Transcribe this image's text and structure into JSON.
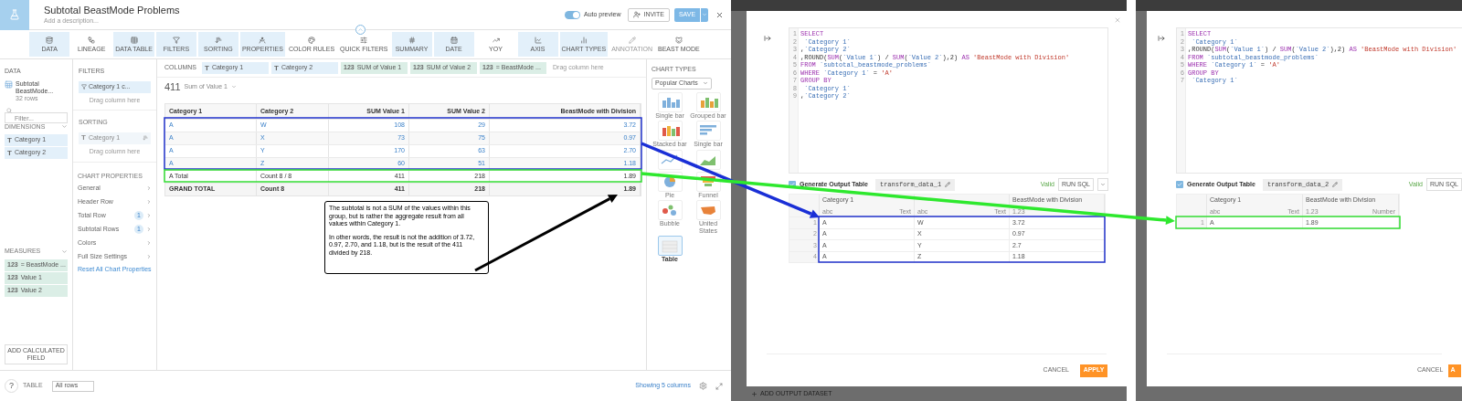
{
  "editor": {
    "title": "Subtotal BeastMode Problems",
    "description": "Add a description...",
    "auto_preview": {
      "label": "Auto preview",
      "on": true
    },
    "invite": "INVITE",
    "save": "SAVE"
  },
  "toolbar": [
    {
      "label": "DATA",
      "selected": true,
      "disabled": false
    },
    {
      "label": "LINEAGE",
      "selected": false,
      "disabled": false
    },
    {
      "label": "DATA TABLE",
      "selected": true,
      "disabled": false
    },
    {
      "label": "FILTERS",
      "selected": true,
      "disabled": false
    },
    {
      "label": "SORTING",
      "selected": true,
      "disabled": false
    },
    {
      "label": "PROPERTIES",
      "selected": true,
      "disabled": false
    },
    {
      "label": "COLOR RULES",
      "selected": false,
      "disabled": false
    },
    {
      "label": "QUICK FILTERS",
      "selected": false,
      "disabled": false
    },
    {
      "label": "SUMMARY",
      "selected": true,
      "disabled": false
    },
    {
      "label": "DATE",
      "selected": true,
      "disabled": false
    },
    {
      "label": "YOY",
      "selected": false,
      "disabled": false
    },
    {
      "label": "AXIS",
      "selected": true,
      "disabled": false
    },
    {
      "label": "CHART TYPES",
      "selected": true,
      "disabled": false
    },
    {
      "label": "ANNOTATION",
      "selected": false,
      "disabled": true
    },
    {
      "label": "BEAST MODE",
      "selected": false,
      "disabled": false
    }
  ],
  "data_panel": {
    "heading": "DATA",
    "dataset": {
      "name": "Subtotal BeastMode...",
      "rows": "32 rows"
    },
    "filter_placeholder": "Filter...",
    "dimensions": {
      "heading": "DIMENSIONS",
      "items": [
        {
          "type": "T",
          "label": "Category 1"
        },
        {
          "type": "T",
          "label": "Category 2"
        }
      ]
    },
    "measures": {
      "heading": "MEASURES",
      "items": [
        {
          "type": "123",
          "label": "= BeastMode ..."
        },
        {
          "type": "123",
          "label": "Value 1"
        },
        {
          "type": "123",
          "label": "Value 2"
        }
      ]
    },
    "add_button": "ADD CALCULATED FIELD"
  },
  "filters_panel": {
    "heading": "FILTERS",
    "chips": [
      "Category 1 c..."
    ],
    "drop_hint": "Drag column here",
    "sorting": {
      "heading": "SORTING",
      "chips": [
        {
          "type": "T",
          "label": "Category 1"
        }
      ],
      "drop_hint": "Drag column here"
    },
    "properties": {
      "heading": "CHART PROPERTIES",
      "items": [
        {
          "label": "General"
        },
        {
          "label": "Header Row"
        },
        {
          "label": "Total Row",
          "count": "1"
        },
        {
          "label": "Subtotal Rows",
          "count": "1"
        },
        {
          "label": "Colors"
        },
        {
          "label": "Full Size Settings"
        }
      ],
      "reset": "Reset All Chart Properties"
    }
  },
  "columns_bar": {
    "label": "COLUMNS",
    "chips": [
      {
        "type": "T",
        "label": "Category 1",
        "kind": "dimension"
      },
      {
        "type": "T",
        "label": "Category 2",
        "kind": "dimension"
      },
      {
        "type": "123",
        "label": "SUM of Value 1",
        "kind": "measure"
      },
      {
        "type": "123",
        "label": "SUM of Value 2",
        "kind": "measure"
      },
      {
        "type": "123",
        "label": "= BeastMode ...",
        "kind": "measure"
      }
    ],
    "drop_hint": "Drag column here"
  },
  "summary": {
    "value": "411",
    "label": "Sum of Value 1"
  },
  "table": {
    "columns": [
      "Category 1",
      "Category 2",
      "SUM Value 1",
      "SUM Value 2",
      "BeastMode with Division"
    ],
    "rows": [
      {
        "kind": "data",
        "cells": [
          "A",
          "W",
          "108",
          "29",
          "3.72"
        ]
      },
      {
        "kind": "data",
        "cells": [
          "A",
          "X",
          "73",
          "75",
          "0.97"
        ]
      },
      {
        "kind": "data",
        "cells": [
          "A",
          "Y",
          "170",
          "63",
          "2.70"
        ]
      },
      {
        "kind": "data",
        "cells": [
          "A",
          "Z",
          "60",
          "51",
          "1.18"
        ]
      },
      {
        "kind": "subtotal",
        "cells": [
          "A Total",
          "Count 8 / 8",
          "411",
          "218",
          "1.89"
        ]
      },
      {
        "kind": "total",
        "cells": [
          "GRAND TOTAL",
          "Count 8",
          "411",
          "218",
          "1.89"
        ]
      }
    ]
  },
  "note": [
    "The subtotal is not a SUM of the values within this group, but is rather the aggregate result from all values within Category 1.",
    "In other words, the result is not the addition of 3.72, 0.97, 2.70, and 1.18, but is the result of the 411 divided by 218."
  ],
  "chart_types": {
    "heading": "CHART TYPES",
    "dropdown": "Popular Charts",
    "tiles": [
      {
        "label": "Single bar",
        "selected": false
      },
      {
        "label": "Grouped bar",
        "selected": false
      },
      {
        "label": "Stacked bar",
        "selected": false
      },
      {
        "label": "Single bar",
        "selected": false
      },
      {
        "selected": false
      },
      {
        "selected": false
      },
      {
        "label": "Pie",
        "selected": false
      },
      {
        "label": "Funnel",
        "selected": false
      },
      {
        "label": "Bubble",
        "selected": false
      },
      {
        "label": "United States",
        "selected": false
      },
      {
        "label": "Table",
        "selected": true
      }
    ]
  },
  "footer": {
    "help": "?",
    "view": "TABLE",
    "rows_select": "All rows",
    "columns_info": "Showing 5 columns"
  },
  "sql_modals": [
    {
      "code": [
        {
          "n": "1",
          "tokens": [
            {
              "t": "SELECT",
              "kind": "keyword"
            }
          ]
        },
        {
          "n": "2",
          "tokens": [
            {
              "t": " `Category 1`",
              "kind": "identifier"
            }
          ]
        },
        {
          "n": "3",
          "tokens": [
            {
              "t": ",",
              "kind": "plain"
            },
            {
              "t": "`Category 2`",
              "kind": "identifier"
            }
          ]
        },
        {
          "n": "4",
          "tokens": [
            {
              "t": ",ROUND(",
              "kind": "plain"
            },
            {
              "t": "SUM",
              "kind": "keyword"
            },
            {
              "t": "(",
              "kind": "plain"
            },
            {
              "t": "`Value 1`",
              "kind": "identifier"
            },
            {
              "t": ") / ",
              "kind": "plain"
            },
            {
              "t": "SUM",
              "kind": "keyword"
            },
            {
              "t": "(",
              "kind": "plain"
            },
            {
              "t": "`Value 2`",
              "kind": "identifier"
            },
            {
              "t": "),2) ",
              "kind": "plain"
            },
            {
              "t": "AS",
              "kind": "keyword"
            },
            {
              "t": " 'BeastMode with Division'",
              "kind": "string"
            }
          ]
        },
        {
          "n": "5",
          "tokens": [
            {
              "t": "FROM",
              "kind": "keyword"
            },
            {
              "t": " `subtotal_beastmode_problems`",
              "kind": "identifier"
            }
          ]
        },
        {
          "n": "6",
          "tokens": [
            {
              "t": "WHERE",
              "kind": "keyword"
            },
            {
              "t": " `Category 1`",
              "kind": "identifier"
            },
            {
              "t": " = ",
              "kind": "plain"
            },
            {
              "t": "'A'",
              "kind": "string"
            }
          ]
        },
        {
          "n": "7",
          "tokens": [
            {
              "t": "GROUP BY",
              "kind": "keyword"
            }
          ]
        },
        {
          "n": "8",
          "tokens": [
            {
              "t": " `Category 1`",
              "kind": "identifier"
            }
          ]
        },
        {
          "n": "9",
          "tokens": [
            {
              "t": ",",
              "kind": "plain"
            },
            {
              "t": "`Category 2`",
              "kind": "identifier"
            }
          ]
        }
      ],
      "generate": {
        "label": "Generate Output Table",
        "checked": true
      },
      "output_name": "transform_data_1",
      "status": "Valid",
      "run": "RUN SQL",
      "output": {
        "columns": [
          {
            "name": "Category 1",
            "type_glyph": "abc",
            "type": "Text"
          },
          {
            "type_glyph": "abc",
            "type": "Text"
          },
          {
            "name": "BeastMode with Division",
            "type_glyph": "1.23"
          }
        ],
        "rows": [
          {
            "n": "1",
            "cells": [
              "A",
              "W",
              "3.72"
            ]
          },
          {
            "n": "2",
            "cells": [
              "A",
              "X",
              "0.97"
            ]
          },
          {
            "n": "3",
            "cells": [
              "A",
              "Y",
              "2.7"
            ]
          },
          {
            "n": "4",
            "cells": [
              "A",
              "Z",
              "1.18"
            ]
          }
        ]
      },
      "cancel": "CANCEL",
      "apply": "APPLY"
    },
    {
      "code": [
        {
          "n": "1",
          "tokens": [
            {
              "t": "SELECT",
              "kind": "keyword"
            }
          ]
        },
        {
          "n": "2",
          "tokens": [
            {
              "t": " `Category 1`",
              "kind": "identifier"
            }
          ]
        },
        {
          "n": "3",
          "tokens": [
            {
              "t": ",ROUND(",
              "kind": "plain"
            },
            {
              "t": "SUM",
              "kind": "keyword"
            },
            {
              "t": "(",
              "kind": "plain"
            },
            {
              "t": "`Value 1`",
              "kind": "identifier"
            },
            {
              "t": ") / ",
              "kind": "plain"
            },
            {
              "t": "SUM",
              "kind": "keyword"
            },
            {
              "t": "(",
              "kind": "plain"
            },
            {
              "t": "`Value 2`",
              "kind": "identifier"
            },
            {
              "t": "),2) ",
              "kind": "plain"
            },
            {
              "t": "AS",
              "kind": "keyword"
            },
            {
              "t": " 'BeastMode with Division'",
              "kind": "string"
            }
          ]
        },
        {
          "n": "4",
          "tokens": [
            {
              "t": "FROM",
              "kind": "keyword"
            },
            {
              "t": " `subtotal_beastmode_problems`",
              "kind": "identifier"
            }
          ]
        },
        {
          "n": "5",
          "tokens": [
            {
              "t": "WHERE",
              "kind": "keyword"
            },
            {
              "t": " `Category 1`",
              "kind": "identifier"
            },
            {
              "t": " = ",
              "kind": "plain"
            },
            {
              "t": "'A'",
              "kind": "string"
            }
          ]
        },
        {
          "n": "6",
          "tokens": [
            {
              "t": "GROUP BY",
              "kind": "keyword"
            }
          ]
        },
        {
          "n": "7",
          "tokens": [
            {
              "t": " `Category 1`",
              "kind": "identifier"
            }
          ]
        }
      ],
      "generate": {
        "label": "Generate Output Table",
        "checked": true
      },
      "output_name": "transform_data_2",
      "status": "Valid",
      "run": "RUN SQL",
      "output": {
        "columns": [
          {
            "name": "Category 1",
            "type_glyph": "abc",
            "type": "Text"
          },
          {
            "name": "BeastMode with Division",
            "type_glyph": "1.23",
            "type": "Number"
          }
        ],
        "rows": [
          {
            "n": "1",
            "cells": [
              "A",
              "1.89"
            ]
          }
        ]
      },
      "cancel": "CANCEL",
      "apply": "A"
    }
  ],
  "background_page": {
    "add_output": "ADD OUTPUT DATASET"
  }
}
